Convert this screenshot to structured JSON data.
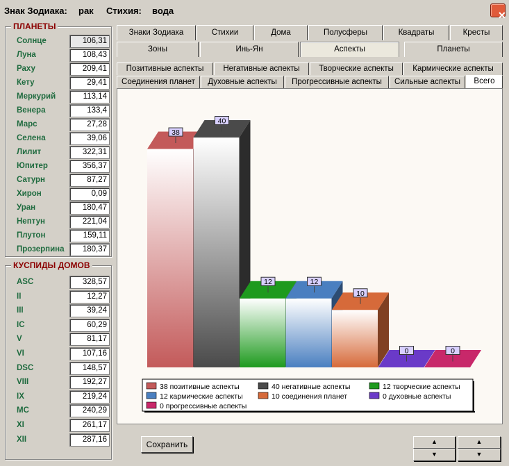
{
  "title": {
    "sign_label": "Знак Зодиака:",
    "sign_value": "рак",
    "element_label": "Стихия:",
    "element_value": "вода"
  },
  "planets": {
    "title": "ПЛАНЕТЫ",
    "items": [
      {
        "label": "Солнце",
        "value": "106,31"
      },
      {
        "label": "Луна",
        "value": "108,43"
      },
      {
        "label": "Раху",
        "value": "209,41"
      },
      {
        "label": "Кету",
        "value": "29,41"
      },
      {
        "label": "Меркурий",
        "value": "113,14"
      },
      {
        "label": "Венера",
        "value": "133,4"
      },
      {
        "label": "Марс",
        "value": "27,28"
      },
      {
        "label": "Селена",
        "value": "39,06"
      },
      {
        "label": "Лилит",
        "value": "322,31"
      },
      {
        "label": "Юпитер",
        "value": "356,37"
      },
      {
        "label": "Сатурн",
        "value": "87,27"
      },
      {
        "label": "Хирон",
        "value": "0,09"
      },
      {
        "label": "Уран",
        "value": "180,47"
      },
      {
        "label": "Нептун",
        "value": "221,04"
      },
      {
        "label": "Плутон",
        "value": "159,11"
      },
      {
        "label": "Прозерпина",
        "value": "180,37"
      }
    ]
  },
  "houses": {
    "title": "КУСПИДЫ ДОМОВ",
    "items": [
      {
        "label": "ASC",
        "value": "328,57"
      },
      {
        "label": "II",
        "value": "12,27"
      },
      {
        "label": "III",
        "value": "39,24"
      },
      {
        "label": "IC",
        "value": "60,29"
      },
      {
        "label": "V",
        "value": "81,17"
      },
      {
        "label": "VI",
        "value": "107,16"
      },
      {
        "label": "DSC",
        "value": "148,57"
      },
      {
        "label": "VIII",
        "value": "192,27"
      },
      {
        "label": "IX",
        "value": "219,24"
      },
      {
        "label": "MC",
        "value": "240,29"
      },
      {
        "label": "XI",
        "value": "261,17"
      },
      {
        "label": "XII",
        "value": "287,16"
      }
    ]
  },
  "tabs_row1": [
    "Знаки Зодиака",
    "Стихии",
    "Дома",
    "Полусферы",
    "Квадраты",
    "Кресты"
  ],
  "tabs_row2": [
    "Зоны",
    "Инь-Ян",
    "Аспекты",
    "Планеты"
  ],
  "tabs_row2_active": "Аспекты",
  "subtabs_row1": [
    "Позитивные аспекты",
    "Негативные аспекты",
    "Творческие аспекты",
    "Кармические аспекты"
  ],
  "subtabs_row2": [
    "Соединения планет",
    "Духовные аспекты",
    "Прогрессивные аспекты",
    "Сильные аспекты",
    "Всего"
  ],
  "subtabs_active": "Всего",
  "save_label": "Сохранить",
  "colors": {
    "positive": "#c35a5a",
    "negative": "#4a4a4a",
    "creative": "#1e9a1e",
    "karmic": "#4a7fc0",
    "conjunction": "#d66a3a",
    "spiritual": "#6a3ac8",
    "progressive": "#c8286a"
  },
  "chart_data": {
    "type": "bar",
    "categories": [
      "позитивные аспекты",
      "негативные аспекты",
      "творческие аспекты",
      "кармические аспекты",
      "соединения планет",
      "духовные аспекты",
      "прогрессивные аспекты"
    ],
    "values": [
      38,
      40,
      12,
      12,
      10,
      0,
      0
    ],
    "legend": [
      "38 позитивные аспекты",
      "40 негативные аспекты",
      "12 творческие аспекты",
      "12 кармические аспекты",
      "10 соединения планет",
      "0 духовные аспекты",
      "0 прогрессивные аспекты"
    ],
    "legend_position": "bottom",
    "style": "3d"
  }
}
